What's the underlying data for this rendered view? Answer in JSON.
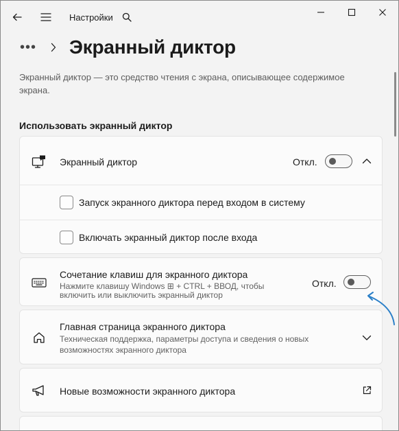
{
  "titlebar": {
    "app_title": "Настройки",
    "icons": [
      "back-arrow-icon",
      "hamburger-menu-icon",
      "search-icon",
      "minimize-icon",
      "maximize-icon",
      "close-icon"
    ]
  },
  "breadcrumb": {
    "ellipsis": "•••",
    "title": "Экранный диктор"
  },
  "description": "Экранный диктор — это средство чтения с экрана, описывающее содержимое экрана.",
  "section_title": "Использовать экранный диктор",
  "narrator_card": {
    "label": "Экранный диктор",
    "state": "Откл.",
    "toggle_on": false,
    "options": [
      {
        "label": "Запуск экранного диктора перед входом в систему",
        "checked": false
      },
      {
        "label": "Включать экранный диктор после входа",
        "checked": false
      }
    ]
  },
  "shortcut_card": {
    "label": "Сочетание клавиш для экранного диктора",
    "sub_line1": "Нажмите клавишу Windows ⊞ + CTRL + ВВОД, чтобы",
    "sub_line2": "включить или выключить экранный диктор",
    "state": "Откл.",
    "toggle_on": false
  },
  "home_card": {
    "label": "Главная страница экранного диктора",
    "sub_line1": "Техническая поддержка, параметры доступа и сведения о новых",
    "sub_line2": "возможностях экранного диктора"
  },
  "whatsnew_card": {
    "label": "Новые возможности экранного диктора"
  },
  "colors": {
    "background": "#f3f3f3",
    "card": "#fbfbfb",
    "annotation_arrow": "#2a7fc8"
  }
}
